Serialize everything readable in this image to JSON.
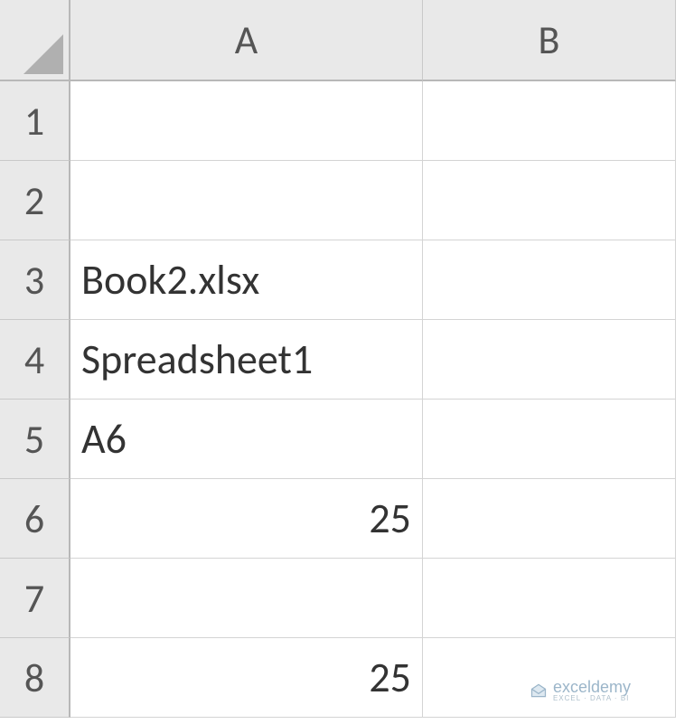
{
  "columns": [
    "A",
    "B"
  ],
  "rows": [
    "1",
    "2",
    "3",
    "4",
    "5",
    "6",
    "7",
    "8"
  ],
  "cells": {
    "A1": {
      "value": "",
      "type": "text"
    },
    "B1": {
      "value": "",
      "type": "text"
    },
    "A2": {
      "value": "",
      "type": "text"
    },
    "B2": {
      "value": "",
      "type": "text"
    },
    "A3": {
      "value": "Book2.xlsx",
      "type": "text"
    },
    "B3": {
      "value": "",
      "type": "text"
    },
    "A4": {
      "value": "Spreadsheet1",
      "type": "text"
    },
    "B4": {
      "value": "",
      "type": "text"
    },
    "A5": {
      "value": "A6",
      "type": "text"
    },
    "B5": {
      "value": "",
      "type": "text"
    },
    "A6": {
      "value": "25",
      "type": "number"
    },
    "B6": {
      "value": "",
      "type": "text"
    },
    "A7": {
      "value": "",
      "type": "text"
    },
    "B7": {
      "value": "",
      "type": "text"
    },
    "A8": {
      "value": "25",
      "type": "number"
    },
    "B8": {
      "value": "",
      "type": "text"
    }
  },
  "watermark": {
    "main": "exceldemy",
    "sub": "EXCEL · DATA · BI"
  }
}
